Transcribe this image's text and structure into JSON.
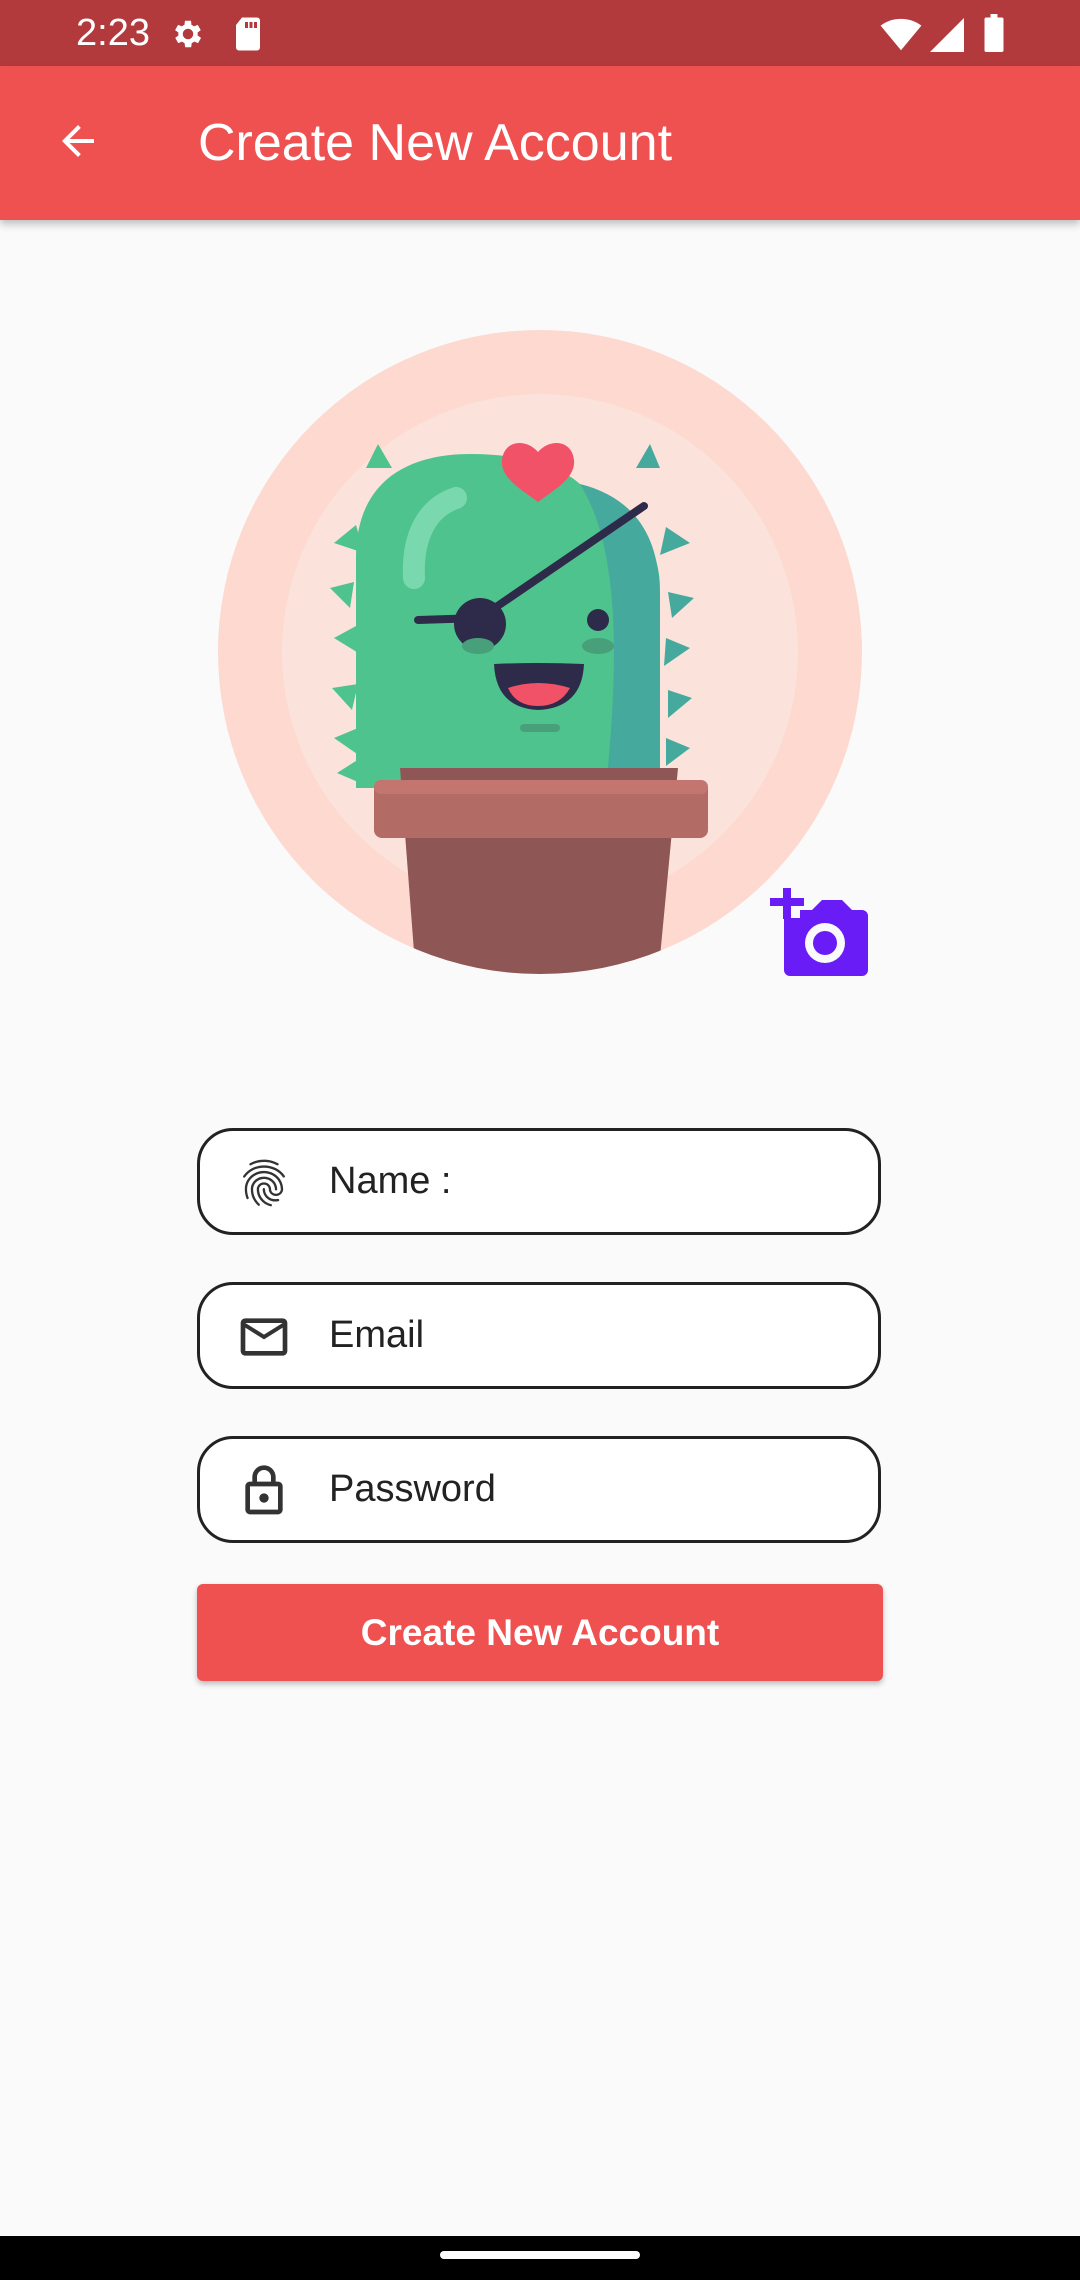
{
  "status_bar": {
    "time": "2:23",
    "icons": [
      "gear-icon",
      "sd-card-icon",
      "wifi-icon",
      "signal-icon",
      "battery-icon"
    ]
  },
  "app_bar": {
    "title": "Create New Account",
    "back_icon": "arrow-back-icon"
  },
  "avatar": {
    "image": "cactus-avatar",
    "camera_icon": "add-a-photo-icon"
  },
  "form": {
    "name": {
      "placeholder": "Name :",
      "icon": "fingerprint-icon"
    },
    "email": {
      "placeholder": "Email",
      "icon": "mail-icon"
    },
    "password": {
      "placeholder": "Password",
      "icon": "lock-icon"
    },
    "submit_label": "Create New Account"
  },
  "colors": {
    "status_bar": "#b23a3d",
    "primary": "#ef5151",
    "camera_accent": "#6a1cf6",
    "avatar_bg_outer": "#fdd9cf",
    "avatar_bg_inner": "#fbe3dc"
  }
}
